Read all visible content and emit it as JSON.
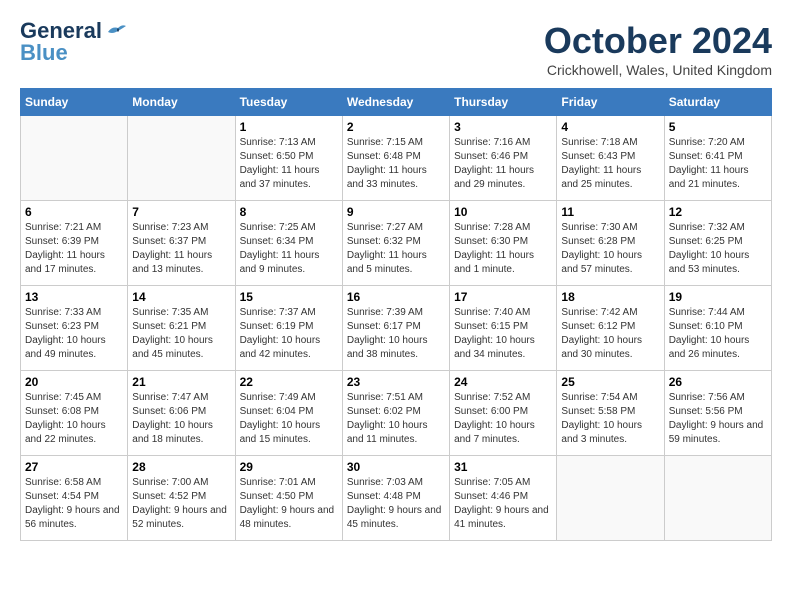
{
  "header": {
    "logo_line1": "General",
    "logo_line2": "Blue",
    "month": "October 2024",
    "location": "Crickhowell, Wales, United Kingdom"
  },
  "weekdays": [
    "Sunday",
    "Monday",
    "Tuesday",
    "Wednesday",
    "Thursday",
    "Friday",
    "Saturday"
  ],
  "weeks": [
    [
      {
        "day": "",
        "info": ""
      },
      {
        "day": "",
        "info": ""
      },
      {
        "day": "1",
        "info": "Sunrise: 7:13 AM\nSunset: 6:50 PM\nDaylight: 11 hours and 37 minutes."
      },
      {
        "day": "2",
        "info": "Sunrise: 7:15 AM\nSunset: 6:48 PM\nDaylight: 11 hours and 33 minutes."
      },
      {
        "day": "3",
        "info": "Sunrise: 7:16 AM\nSunset: 6:46 PM\nDaylight: 11 hours and 29 minutes."
      },
      {
        "day": "4",
        "info": "Sunrise: 7:18 AM\nSunset: 6:43 PM\nDaylight: 11 hours and 25 minutes."
      },
      {
        "day": "5",
        "info": "Sunrise: 7:20 AM\nSunset: 6:41 PM\nDaylight: 11 hours and 21 minutes."
      }
    ],
    [
      {
        "day": "6",
        "info": "Sunrise: 7:21 AM\nSunset: 6:39 PM\nDaylight: 11 hours and 17 minutes."
      },
      {
        "day": "7",
        "info": "Sunrise: 7:23 AM\nSunset: 6:37 PM\nDaylight: 11 hours and 13 minutes."
      },
      {
        "day": "8",
        "info": "Sunrise: 7:25 AM\nSunset: 6:34 PM\nDaylight: 11 hours and 9 minutes."
      },
      {
        "day": "9",
        "info": "Sunrise: 7:27 AM\nSunset: 6:32 PM\nDaylight: 11 hours and 5 minutes."
      },
      {
        "day": "10",
        "info": "Sunrise: 7:28 AM\nSunset: 6:30 PM\nDaylight: 11 hours and 1 minute."
      },
      {
        "day": "11",
        "info": "Sunrise: 7:30 AM\nSunset: 6:28 PM\nDaylight: 10 hours and 57 minutes."
      },
      {
        "day": "12",
        "info": "Sunrise: 7:32 AM\nSunset: 6:25 PM\nDaylight: 10 hours and 53 minutes."
      }
    ],
    [
      {
        "day": "13",
        "info": "Sunrise: 7:33 AM\nSunset: 6:23 PM\nDaylight: 10 hours and 49 minutes."
      },
      {
        "day": "14",
        "info": "Sunrise: 7:35 AM\nSunset: 6:21 PM\nDaylight: 10 hours and 45 minutes."
      },
      {
        "day": "15",
        "info": "Sunrise: 7:37 AM\nSunset: 6:19 PM\nDaylight: 10 hours and 42 minutes."
      },
      {
        "day": "16",
        "info": "Sunrise: 7:39 AM\nSunset: 6:17 PM\nDaylight: 10 hours and 38 minutes."
      },
      {
        "day": "17",
        "info": "Sunrise: 7:40 AM\nSunset: 6:15 PM\nDaylight: 10 hours and 34 minutes."
      },
      {
        "day": "18",
        "info": "Sunrise: 7:42 AM\nSunset: 6:12 PM\nDaylight: 10 hours and 30 minutes."
      },
      {
        "day": "19",
        "info": "Sunrise: 7:44 AM\nSunset: 6:10 PM\nDaylight: 10 hours and 26 minutes."
      }
    ],
    [
      {
        "day": "20",
        "info": "Sunrise: 7:45 AM\nSunset: 6:08 PM\nDaylight: 10 hours and 22 minutes."
      },
      {
        "day": "21",
        "info": "Sunrise: 7:47 AM\nSunset: 6:06 PM\nDaylight: 10 hours and 18 minutes."
      },
      {
        "day": "22",
        "info": "Sunrise: 7:49 AM\nSunset: 6:04 PM\nDaylight: 10 hours and 15 minutes."
      },
      {
        "day": "23",
        "info": "Sunrise: 7:51 AM\nSunset: 6:02 PM\nDaylight: 10 hours and 11 minutes."
      },
      {
        "day": "24",
        "info": "Sunrise: 7:52 AM\nSunset: 6:00 PM\nDaylight: 10 hours and 7 minutes."
      },
      {
        "day": "25",
        "info": "Sunrise: 7:54 AM\nSunset: 5:58 PM\nDaylight: 10 hours and 3 minutes."
      },
      {
        "day": "26",
        "info": "Sunrise: 7:56 AM\nSunset: 5:56 PM\nDaylight: 9 hours and 59 minutes."
      }
    ],
    [
      {
        "day": "27",
        "info": "Sunrise: 6:58 AM\nSunset: 4:54 PM\nDaylight: 9 hours and 56 minutes."
      },
      {
        "day": "28",
        "info": "Sunrise: 7:00 AM\nSunset: 4:52 PM\nDaylight: 9 hours and 52 minutes."
      },
      {
        "day": "29",
        "info": "Sunrise: 7:01 AM\nSunset: 4:50 PM\nDaylight: 9 hours and 48 minutes."
      },
      {
        "day": "30",
        "info": "Sunrise: 7:03 AM\nSunset: 4:48 PM\nDaylight: 9 hours and 45 minutes."
      },
      {
        "day": "31",
        "info": "Sunrise: 7:05 AM\nSunset: 4:46 PM\nDaylight: 9 hours and 41 minutes."
      },
      {
        "day": "",
        "info": ""
      },
      {
        "day": "",
        "info": ""
      }
    ]
  ]
}
